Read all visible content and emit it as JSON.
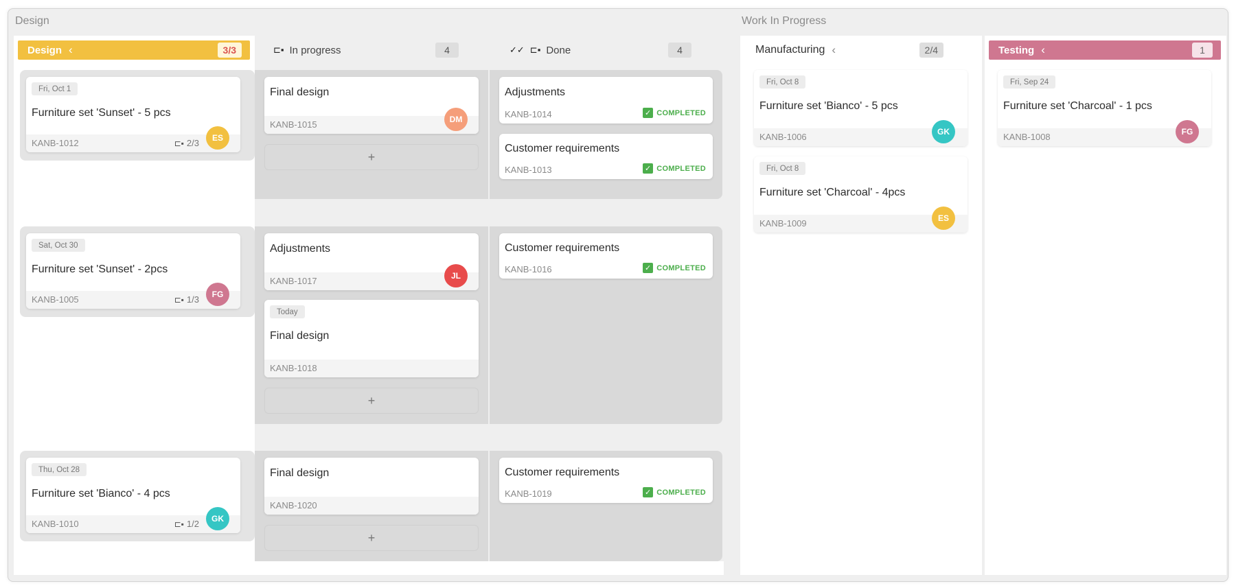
{
  "sections": {
    "design": "Design",
    "wip": "Work In Progress"
  },
  "columns": {
    "design": {
      "title": "Design",
      "count": "3/3",
      "color": "#f2c040"
    },
    "in_progress": {
      "title": "In progress",
      "count": "4"
    },
    "done": {
      "title": "Done",
      "count": "4"
    },
    "manufacturing": {
      "title": "Manufacturing",
      "count": "2/4"
    },
    "testing": {
      "title": "Testing",
      "count": "1",
      "color": "#cf7790"
    }
  },
  "icons": {
    "collapse": "chevron-left-icon",
    "subtask": "subtask-icon",
    "done": "double-check-icon",
    "check": "check-icon",
    "add": "plus-icon"
  },
  "completed_label": "COMPLETED",
  "lanes": [
    {
      "parent": {
        "date": "Fri, Oct 1",
        "title": "Furniture set 'Sunset' - 5 pcs",
        "id": "KANB-1012",
        "subtasks": "2/3",
        "avatar": "ES",
        "avatar_color": "#f2c040"
      },
      "in_progress": [
        {
          "title": "Final design",
          "id": "KANB-1015",
          "avatar": "DM",
          "avatar_color": "#f59e7a"
        }
      ],
      "done": [
        {
          "title": "Adjustments",
          "id": "KANB-1014"
        },
        {
          "title": "Customer requirements",
          "id": "KANB-1013"
        }
      ]
    },
    {
      "parent": {
        "date": "Sat, Oct 30",
        "title": "Furniture set 'Sunset' - 2pcs",
        "id": "KANB-1005",
        "subtasks": "1/3",
        "avatar": "FG",
        "avatar_color": "#cf7790"
      },
      "in_progress": [
        {
          "title": "Adjustments",
          "id": "KANB-1017",
          "avatar": "JL",
          "avatar_color": "#e84b4b"
        },
        {
          "date": "Today",
          "title": "Final design",
          "id": "KANB-1018"
        }
      ],
      "done": [
        {
          "title": "Customer requirements",
          "id": "KANB-1016"
        }
      ]
    },
    {
      "parent": {
        "date": "Thu, Oct 28",
        "title": "Furniture set 'Bianco' - 4 pcs",
        "id": "KANB-1010",
        "subtasks": "1/2",
        "avatar": "GK",
        "avatar_color": "#35c6c4"
      },
      "in_progress": [
        {
          "title": "Final design",
          "id": "KANB-1020"
        }
      ],
      "done": [
        {
          "title": "Customer requirements",
          "id": "KANB-1019"
        }
      ]
    }
  ],
  "manufacturing_cards": [
    {
      "date": "Fri, Oct 8",
      "title": "Furniture set 'Bianco' - 5 pcs",
      "id": "KANB-1006",
      "avatar": "GK",
      "avatar_color": "#35c6c4"
    },
    {
      "date": "Fri, Oct 8",
      "title": "Furniture set 'Charcoal' - 4pcs",
      "id": "KANB-1009",
      "avatar": "ES",
      "avatar_color": "#f2c040"
    }
  ],
  "testing_cards": [
    {
      "date": "Fri, Sep 24",
      "title": "Furniture set 'Charcoal' - 1 pcs",
      "id": "KANB-1008",
      "avatar": "FG",
      "avatar_color": "#cf7790"
    }
  ]
}
